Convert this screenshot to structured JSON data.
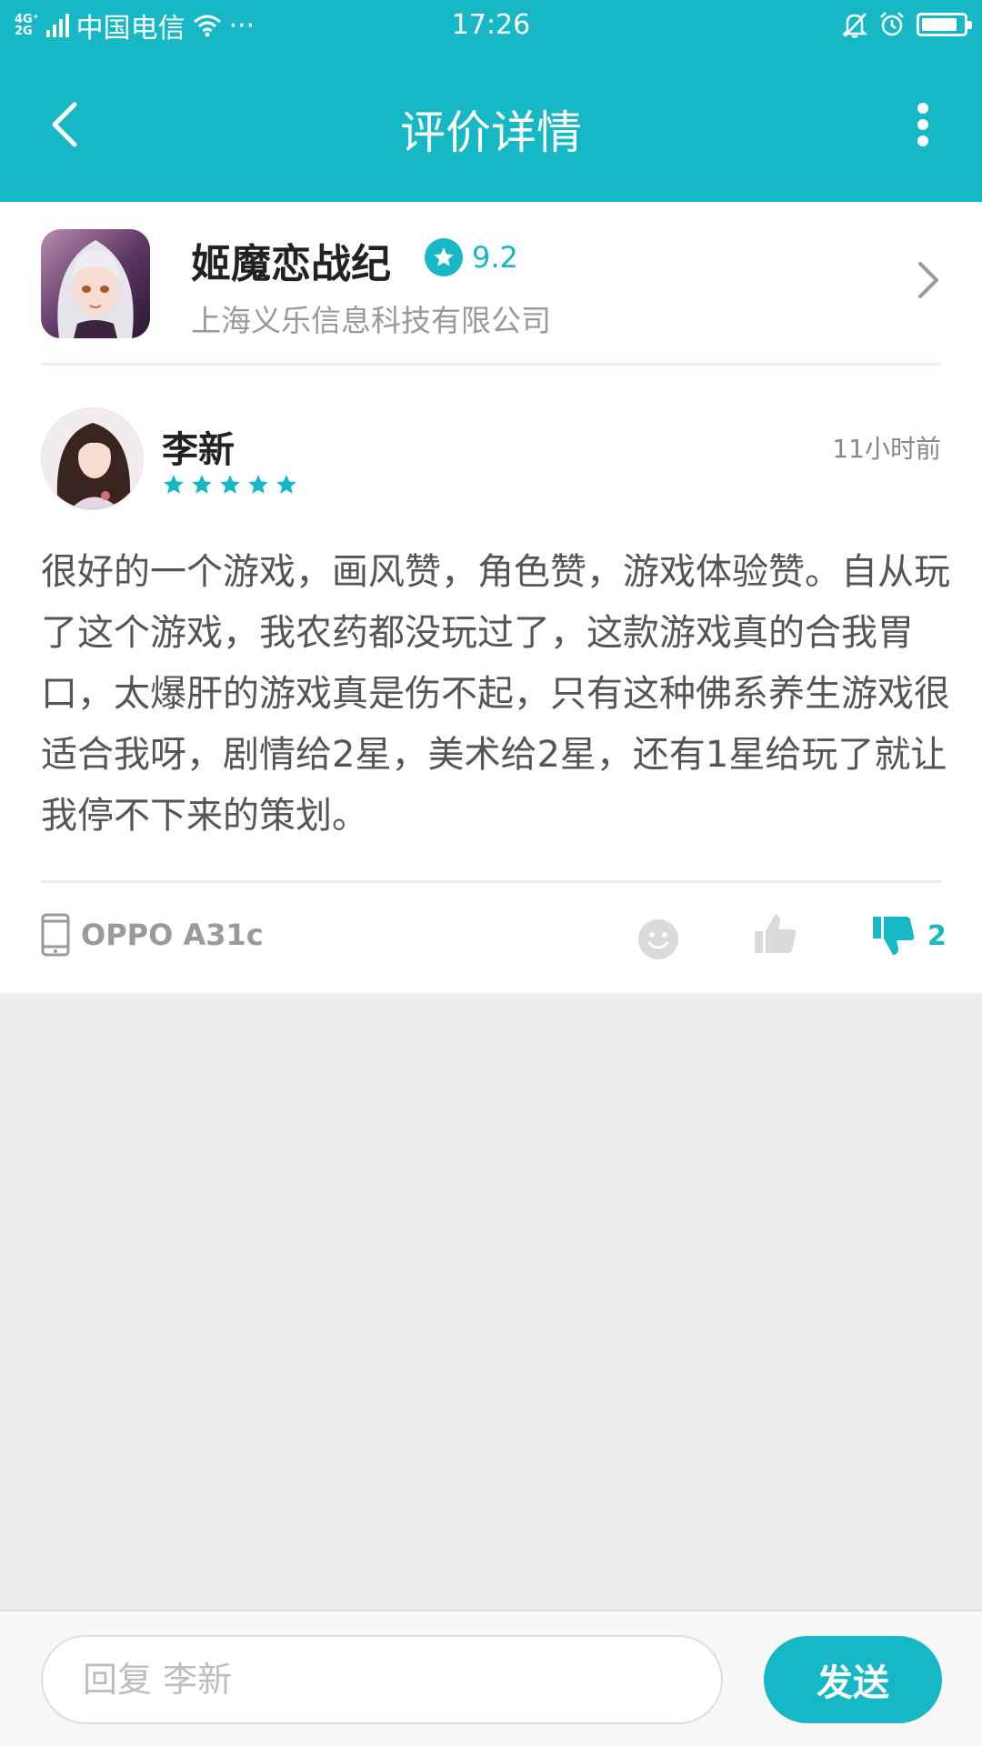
{
  "status_bar": {
    "network_top": "4G⁺",
    "network_bottom": "2G",
    "carrier": "中国电信",
    "more_dots": "···",
    "time": "17:26"
  },
  "header": {
    "title": "评价详情"
  },
  "app": {
    "name": "姬魔恋战纪",
    "rating": "9.2",
    "developer": "上海义乐信息科技有限公司"
  },
  "review": {
    "user_name": "李新",
    "stars": 5,
    "time": "11小时前",
    "text": "很好的一个游戏，画风赞，角色赞，游戏体验赞。自从玩了这个游戏，我农药都没玩过了，这款游戏真的合我胃口，太爆肝的游戏真是伤不起，只有这种佛系养生游戏很适合我呀，剧情给2星，美术给2星，还有1星给玩了就让我停不下来的策划。",
    "device": "OPPO A31c",
    "dislike_count": "2"
  },
  "reply": {
    "placeholder": "回复 李新",
    "send_label": "发送"
  },
  "colors": {
    "accent": "#16b8c6",
    "background": "#eeeeee"
  }
}
